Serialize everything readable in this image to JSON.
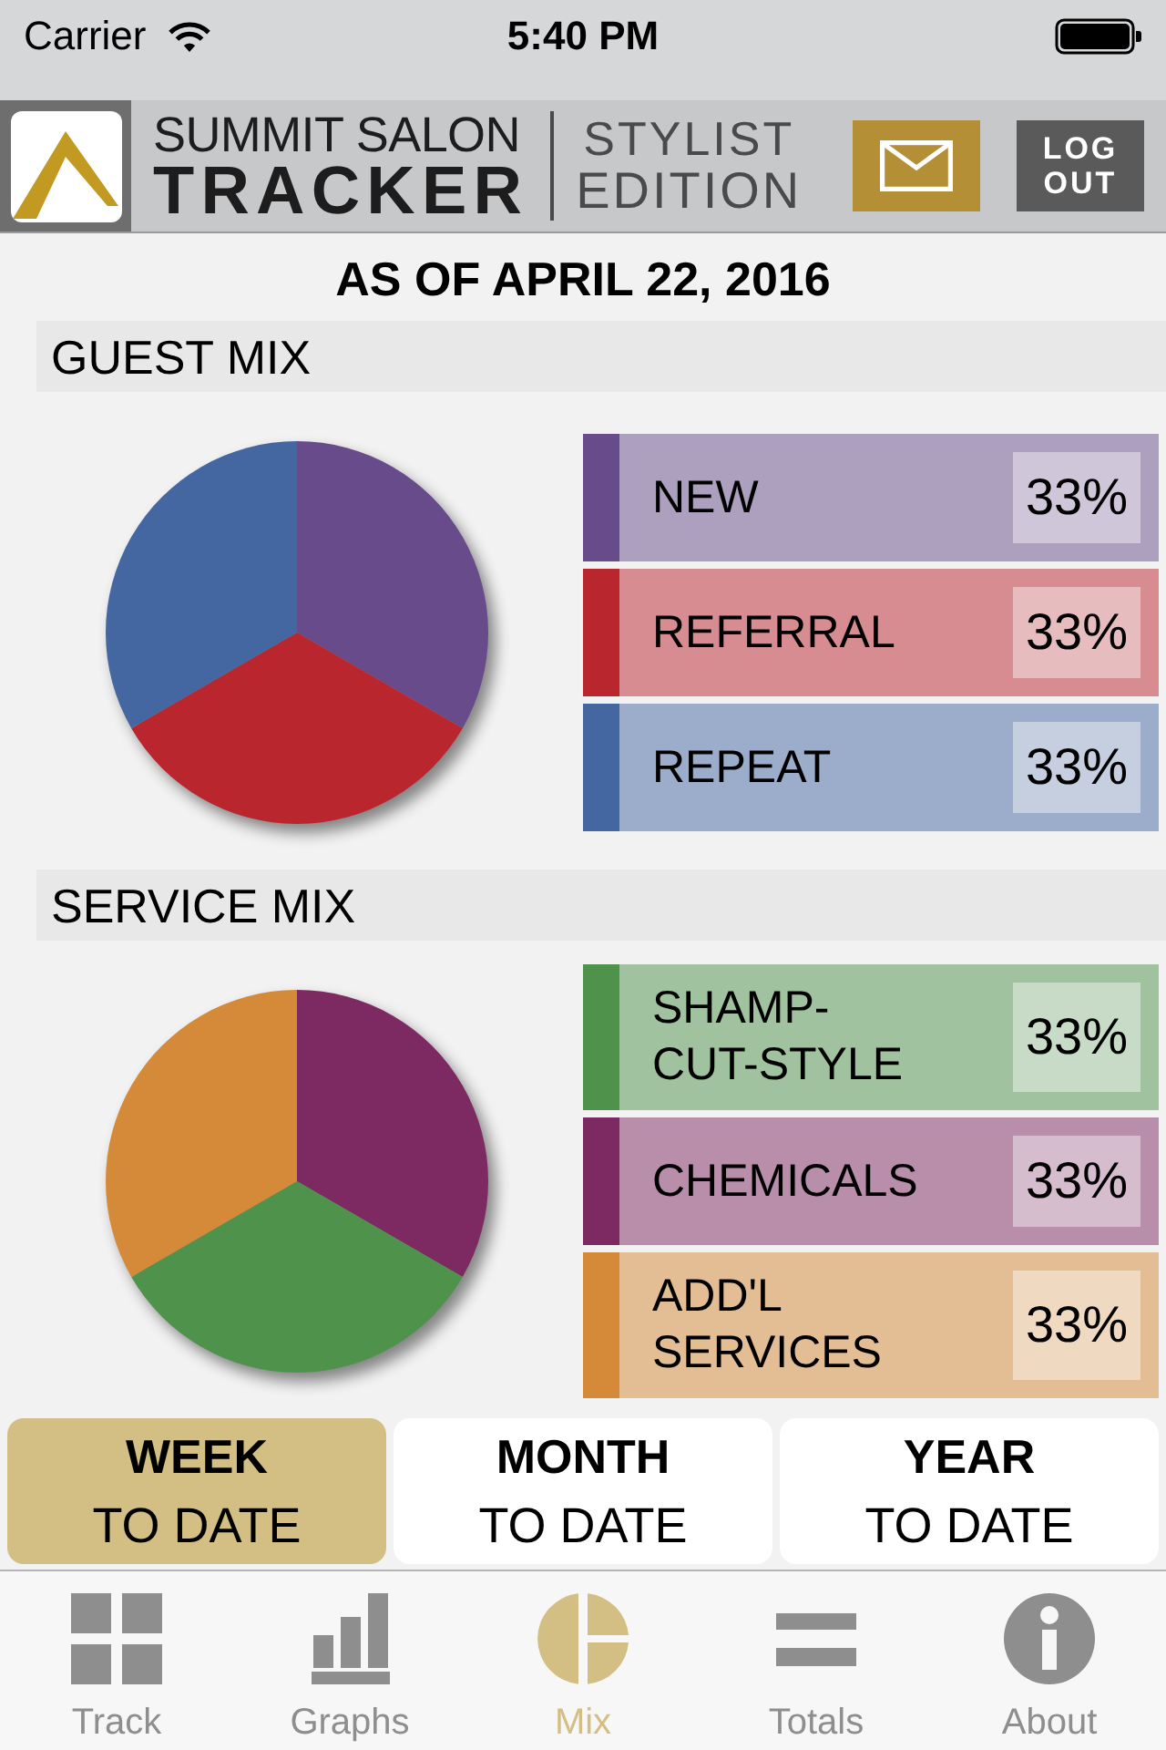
{
  "status_bar": {
    "carrier": "Carrier",
    "time": "5:40 PM"
  },
  "header": {
    "brand_top": "SUMMIT SALON",
    "brand_bottom": "TRACKER",
    "edition_top": "STYLIST",
    "edition_bottom": "EDITION",
    "logout_button": "LOG OUT"
  },
  "date_heading": "AS OF APRIL 22, 2016",
  "sections": [
    {
      "title": "GUEST MIX",
      "chart_data": {
        "type": "pie",
        "values": [
          33,
          33,
          33
        ],
        "colors": [
          "#684b8a",
          "#b9262d",
          "#4467a1"
        ]
      },
      "legend": [
        {
          "label": "NEW",
          "percent": "33%",
          "color": "#684b8a"
        },
        {
          "label": "REFERRAL",
          "percent": "33%",
          "color": "#b9262d"
        },
        {
          "label": "REPEAT",
          "percent": "33%",
          "color": "#4467a1"
        }
      ]
    },
    {
      "title": "SERVICE MIX",
      "chart_data": {
        "type": "pie",
        "values": [
          33,
          33,
          33
        ],
        "colors": [
          "#7e2a62",
          "#4f924c",
          "#d48a38"
        ]
      },
      "legend": [
        {
          "label": "SHAMP-CUT-STYLE",
          "percent": "33%",
          "color": "#4f924c"
        },
        {
          "label": "CHEMICALS",
          "percent": "33%",
          "color": "#7e2a62"
        },
        {
          "label": "ADD'L SERVICES",
          "percent": "33%",
          "color": "#d48a38"
        }
      ]
    }
  ],
  "periods": [
    {
      "title": "WEEK",
      "subtitle": "TO DATE",
      "selected": true
    },
    {
      "title": "MONTH",
      "subtitle": "TO DATE",
      "selected": false
    },
    {
      "title": "YEAR",
      "subtitle": "TO DATE",
      "selected": false
    }
  ],
  "tabs": [
    {
      "label": "Track",
      "selected": false
    },
    {
      "label": "Graphs",
      "selected": false
    },
    {
      "label": "Mix",
      "selected": true
    },
    {
      "label": "Totals",
      "selected": false
    },
    {
      "label": "About",
      "selected": false
    }
  ]
}
